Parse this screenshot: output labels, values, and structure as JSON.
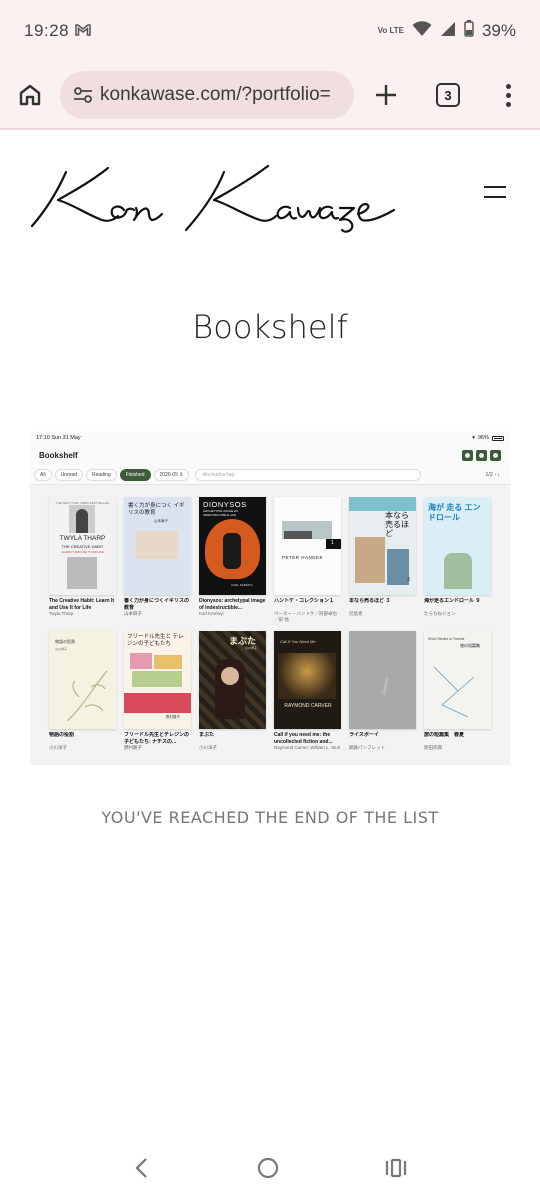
{
  "status_bar": {
    "time": "19:28",
    "network_label": "Vo LTE",
    "battery": "39%"
  },
  "browser": {
    "url": "konkawase.com/?portfolio=",
    "tab_count": "3"
  },
  "site": {
    "logo_text": "Kon Kawase",
    "page_title": "Bookshelf",
    "end_of_list": "YOU'VE REACHED THE END OF THE LIST"
  },
  "embedded_screenshot": {
    "status_time": "17:10  Sun 31 May",
    "status_battery": "96%",
    "app_title": "Bookshelf",
    "filter_chips": [
      "All",
      "Unread",
      "Reading",
      "Finished"
    ],
    "active_chip": "Finished",
    "month_select": "2026-05 ⇕",
    "search_placeholder": "title/author/tag",
    "sort_info": "1/2 ↑↓",
    "books": [
      {
        "title": "The Creative Habit: Learn It and Use It for Life",
        "author": "Twyla Tharp",
        "cover_top": "THE NEW YORK TIMES BESTSELLER",
        "cover_main": "TWYLA THARP",
        "cover_sub": "THE CREATIVE HABIT",
        "cover_tag": "LEARN IT AND USE IT FOR LIFE"
      },
      {
        "title": "書く力が身につくイギリスの教育",
        "author": "山本麻子",
        "cover_main": "書く力が身につく イギリスの教育",
        "cover_sub": "山本麻子"
      },
      {
        "title": "Dionysos: archetypal image of indestructible...",
        "author": "Karl Kerényi",
        "cover_main": "DIONYSOS",
        "cover_sub": "ARCHETYPAL IMAGE OF INDESTRUCTIBLE LIFE",
        "cover_tag": "CARL KERÉNYI"
      },
      {
        "title": "ハントケ・コレクション１",
        "author": "ペーター・ハントケ／阿部卓也／訳 他",
        "cover_main": "PETER HANDKE",
        "cover_tag": "1"
      },
      {
        "title": "本なら売るほど ３",
        "author": "児島青",
        "cover_main": "本なら 売るほど",
        "cover_tag": "3"
      },
      {
        "title": "海が走るエンドロール ９",
        "author": "たらちねジョン",
        "cover_main": "海が 走る エンドロール"
      },
      {
        "title": "物語の役割",
        "author": "小川洋子",
        "cover_main": "物語の役割",
        "cover_sub": "小川洋子"
      },
      {
        "title": "フリードル先生とテレジンの子どもたち: ナチスの...",
        "author": "野村路子",
        "cover_main": "フリードル先生と テレジンの子どもたち",
        "cover_sub": "野村路子"
      },
      {
        "title": "まぶた",
        "author": "小川洋子",
        "cover_main": "まぶた",
        "cover_sub": "小川洋子"
      },
      {
        "title": "Call if you need me: the uncollected fiction and...",
        "author": "Raymond Carver, William L. Stull",
        "cover_main": "RAYMOND CARVER",
        "cover_sub": "Call If You Need Me"
      },
      {
        "title": "ライスボーイ",
        "author": "鋼鉄パンフレット",
        "cover_main": "Riceboy"
      },
      {
        "title": "旅の短篇集　春夏",
        "author": "原田宗典",
        "cover_main": "旅の短篇集",
        "cover_sub": "Short Stories of Travels"
      }
    ]
  },
  "colors": {
    "browser_bg": "#fbf1f1",
    "urlbar_bg": "#f1dfdf",
    "active_chip": "#3d5a3a"
  },
  "icons": [
    "home-icon",
    "site-settings-icon",
    "new-tab-icon",
    "tab-switcher-icon",
    "overflow-menu-icon",
    "hamburger-menu-icon",
    "back-nav-icon",
    "home-nav-icon",
    "recents-nav-icon"
  ]
}
